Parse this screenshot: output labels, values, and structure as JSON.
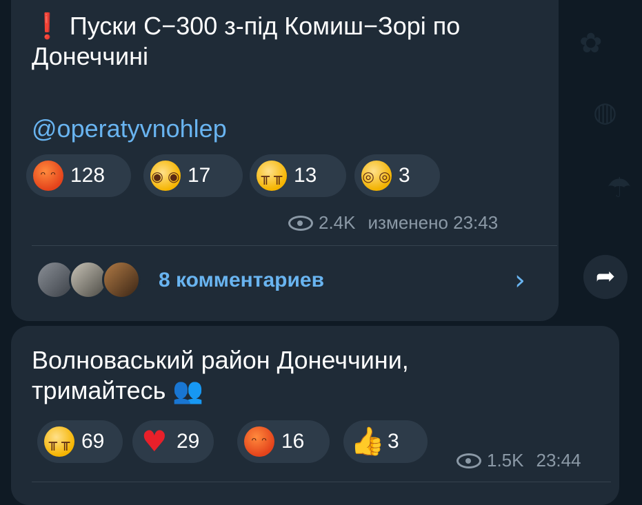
{
  "colors": {
    "background": "#0f1a24",
    "bubble": "#1f2b37",
    "link": "#69b4f0",
    "meta": "#8b99a6"
  },
  "message1": {
    "text_line1": "Пуски С−300 з-під Комиш−Зорі по",
    "text_line2": "Донеччині",
    "exclamation": "❗",
    "link": "@operatyvnohlep",
    "reactions": [
      {
        "emoji": "angry-face",
        "count": "128"
      },
      {
        "emoji": "exploding-head",
        "count": "17"
      },
      {
        "emoji": "crying-face",
        "count": "13"
      },
      {
        "emoji": "screaming-face",
        "count": "3"
      }
    ],
    "views": "2.4K",
    "edited_time": "изменено 23:43",
    "comments_label": "8 комментариев"
  },
  "message2": {
    "text_line1": "Волноваський район Донеччини,",
    "text_line2": "тримайтесь",
    "reactions": [
      {
        "emoji": "crying-face",
        "count": "69"
      },
      {
        "emoji": "red-heart",
        "count": "29"
      },
      {
        "emoji": "angry-face",
        "count": "16"
      },
      {
        "emoji": "thumbs-up",
        "count": "3"
      }
    ],
    "views": "1.5K",
    "time": "23:44"
  },
  "icons": {
    "share": "share-icon",
    "chevron": "chevron-right-icon",
    "hug": "people-hugging-icon"
  }
}
